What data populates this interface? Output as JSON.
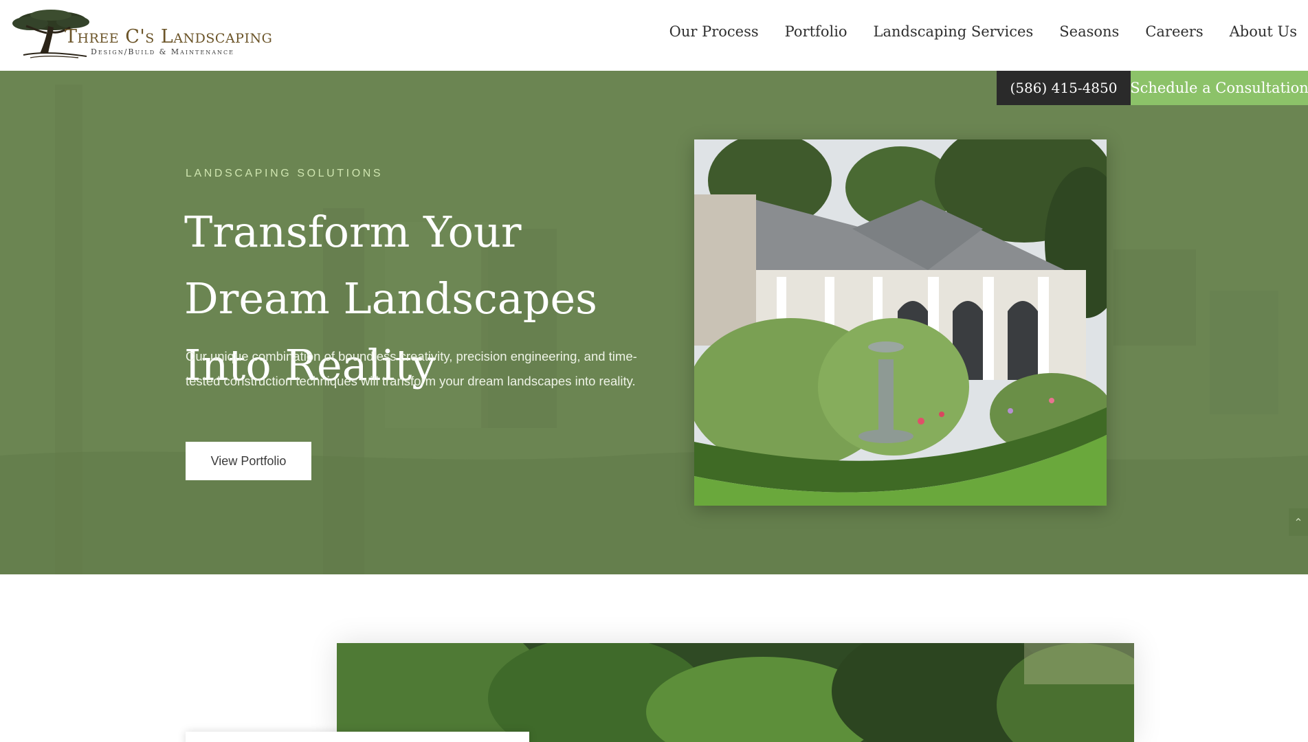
{
  "brand": {
    "name": "Three C's Landscaping",
    "tagline": "Design/Build & Maintenance",
    "logo_icon": "tree-icon"
  },
  "nav": {
    "items": [
      {
        "label": "Our Process"
      },
      {
        "label": "Portfolio"
      },
      {
        "label": "Landscaping Services"
      },
      {
        "label": "Seasons"
      },
      {
        "label": "Careers"
      },
      {
        "label": "About Us"
      }
    ]
  },
  "cta": {
    "phone": "(586) 415-4850",
    "schedule": "Schedule a Consultation"
  },
  "hero": {
    "eyebrow": "LANDSCAPING SOLUTIONS",
    "title": "Transform Your Dream Landscapes Into Reality",
    "body": "Our unique combination of boundless creativity, precision engineering, and time-tested construction techniques will transform your dream landscapes into reality.",
    "button": "View Portfolio",
    "scroll_icon": "chevron-up-icon"
  },
  "colors": {
    "hero_green": "#6b8552",
    "cta_green": "#8cc269",
    "cta_dark": "#2a2a2a",
    "brand_brown": "#6b5428"
  }
}
